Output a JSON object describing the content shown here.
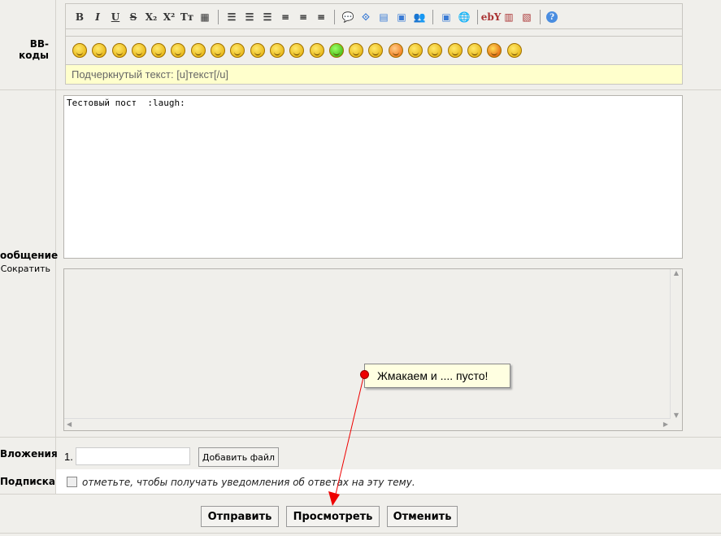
{
  "labels": {
    "bbcodes": "BB-коды",
    "message": "ообщение",
    "shorten": "Сократить",
    "attachments": "Вложения",
    "subscription": "Подписка"
  },
  "toolbar": {
    "format": [
      "B",
      "I",
      "U",
      "S",
      "X₂",
      "X²",
      "Tт",
      "▦"
    ],
    "lists": [
      "☰",
      "☰",
      "☰",
      "≡",
      "≡",
      "≡"
    ],
    "insert": [
      "💬",
      "⟐",
      "▤",
      "▣",
      "👥"
    ],
    "media": [
      "▣",
      "🌐"
    ],
    "ext": [
      "ebY",
      "▥",
      "▧"
    ],
    "help": "?"
  },
  "smiley_count": 23,
  "hint": "Подчеркнутый текст: [u]текст[/u]",
  "message_text": "Тестовый пост  :laugh:",
  "attach": {
    "index": "1.",
    "add_button": "Добавить файл",
    "file_value": ""
  },
  "subscribe_text": "отметьте, чтобы получать уведомления об ответах на эту тему.",
  "buttons": {
    "submit": "Отправить",
    "preview": "Просмотреть",
    "cancel": "Отменить"
  },
  "annotation": "Жмакаем и .... пусто!"
}
